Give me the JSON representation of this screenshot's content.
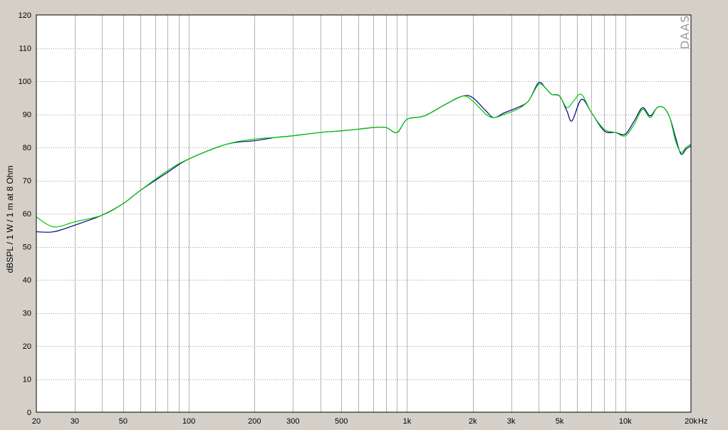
{
  "watermark": "DAAS",
  "chart_data": {
    "type": "line",
    "title": "",
    "xlabel": "",
    "ylabel": "dBSPL / 1 W / 1 m at 8 Ohm",
    "x_scale": "log",
    "xlim": [
      20,
      20000
    ],
    "ylim": [
      0,
      120
    ],
    "grid": true,
    "legend": "none",
    "x_ticks": [
      {
        "value": 20,
        "label": "20"
      },
      {
        "value": 30,
        "label": "30"
      },
      {
        "value": 50,
        "label": "50"
      },
      {
        "value": 100,
        "label": "100"
      },
      {
        "value": 200,
        "label": "200"
      },
      {
        "value": 300,
        "label": "300"
      },
      {
        "value": 500,
        "label": "500"
      },
      {
        "value": 1000,
        "label": "1k"
      },
      {
        "value": 2000,
        "label": "2k"
      },
      {
        "value": 3000,
        "label": "3k"
      },
      {
        "value": 5000,
        "label": "5k"
      },
      {
        "value": 10000,
        "label": "10k"
      },
      {
        "value": 20000,
        "label": "20k"
      }
    ],
    "x_unit": "Hz",
    "y_ticks": [
      0,
      10,
      20,
      30,
      40,
      50,
      60,
      70,
      80,
      90,
      100,
      110,
      120
    ],
    "series": [
      {
        "color": "#000080",
        "x": [
          20,
          24,
          30,
          40,
          50,
          60,
          80,
          100,
          150,
          200,
          250,
          300,
          400,
          500,
          600,
          700,
          800,
          900,
          1000,
          1200,
          1500,
          1800,
          2000,
          2300,
          2500,
          2800,
          3200,
          3600,
          4000,
          4300,
          4600,
          5000,
          5400,
          5700,
          6300,
          7000,
          8000,
          9000,
          10000,
          11000,
          12000,
          13000,
          14000,
          15000,
          16000,
          17000,
          18000,
          19000,
          20000
        ],
        "y": [
          54.5,
          54.5,
          56.5,
          59.5,
          63,
          67,
          72.5,
          76.5,
          81,
          82,
          83,
          83.5,
          84.5,
          85,
          85.5,
          86,
          86,
          84.5,
          88.5,
          89.5,
          93,
          95.5,
          95,
          91,
          89,
          90.5,
          92,
          94,
          99.5,
          98,
          96,
          95.5,
          91,
          88,
          94.5,
          90.5,
          85,
          84.5,
          84,
          88,
          92,
          89.5,
          92,
          92,
          89,
          83,
          78,
          79.5,
          80.5
        ]
      },
      {
        "color": "#00cc00",
        "x": [
          20,
          24,
          30,
          40,
          50,
          60,
          80,
          100,
          150,
          200,
          250,
          300,
          400,
          500,
          600,
          700,
          800,
          900,
          1000,
          1200,
          1500,
          1800,
          2000,
          2300,
          2500,
          2800,
          3200,
          3600,
          4000,
          4300,
          4600,
          5000,
          5400,
          5800,
          6300,
          7000,
          8000,
          9000,
          10000,
          11000,
          12000,
          13000,
          14000,
          15000,
          16000,
          17000,
          18000,
          19000,
          20000
        ],
        "y": [
          59,
          56,
          57.5,
          59.5,
          63,
          67,
          73,
          76.5,
          81,
          82.5,
          83,
          83.5,
          84.5,
          85,
          85.5,
          86,
          86,
          84.5,
          88.5,
          89.5,
          93,
          95.5,
          94,
          90,
          89,
          90,
          91.5,
          94,
          99,
          98,
          96,
          95.5,
          92,
          94,
          96,
          90.5,
          85.5,
          84.5,
          83.5,
          87,
          91.5,
          89,
          92,
          92,
          89,
          82,
          78.5,
          80,
          81
        ]
      }
    ]
  }
}
